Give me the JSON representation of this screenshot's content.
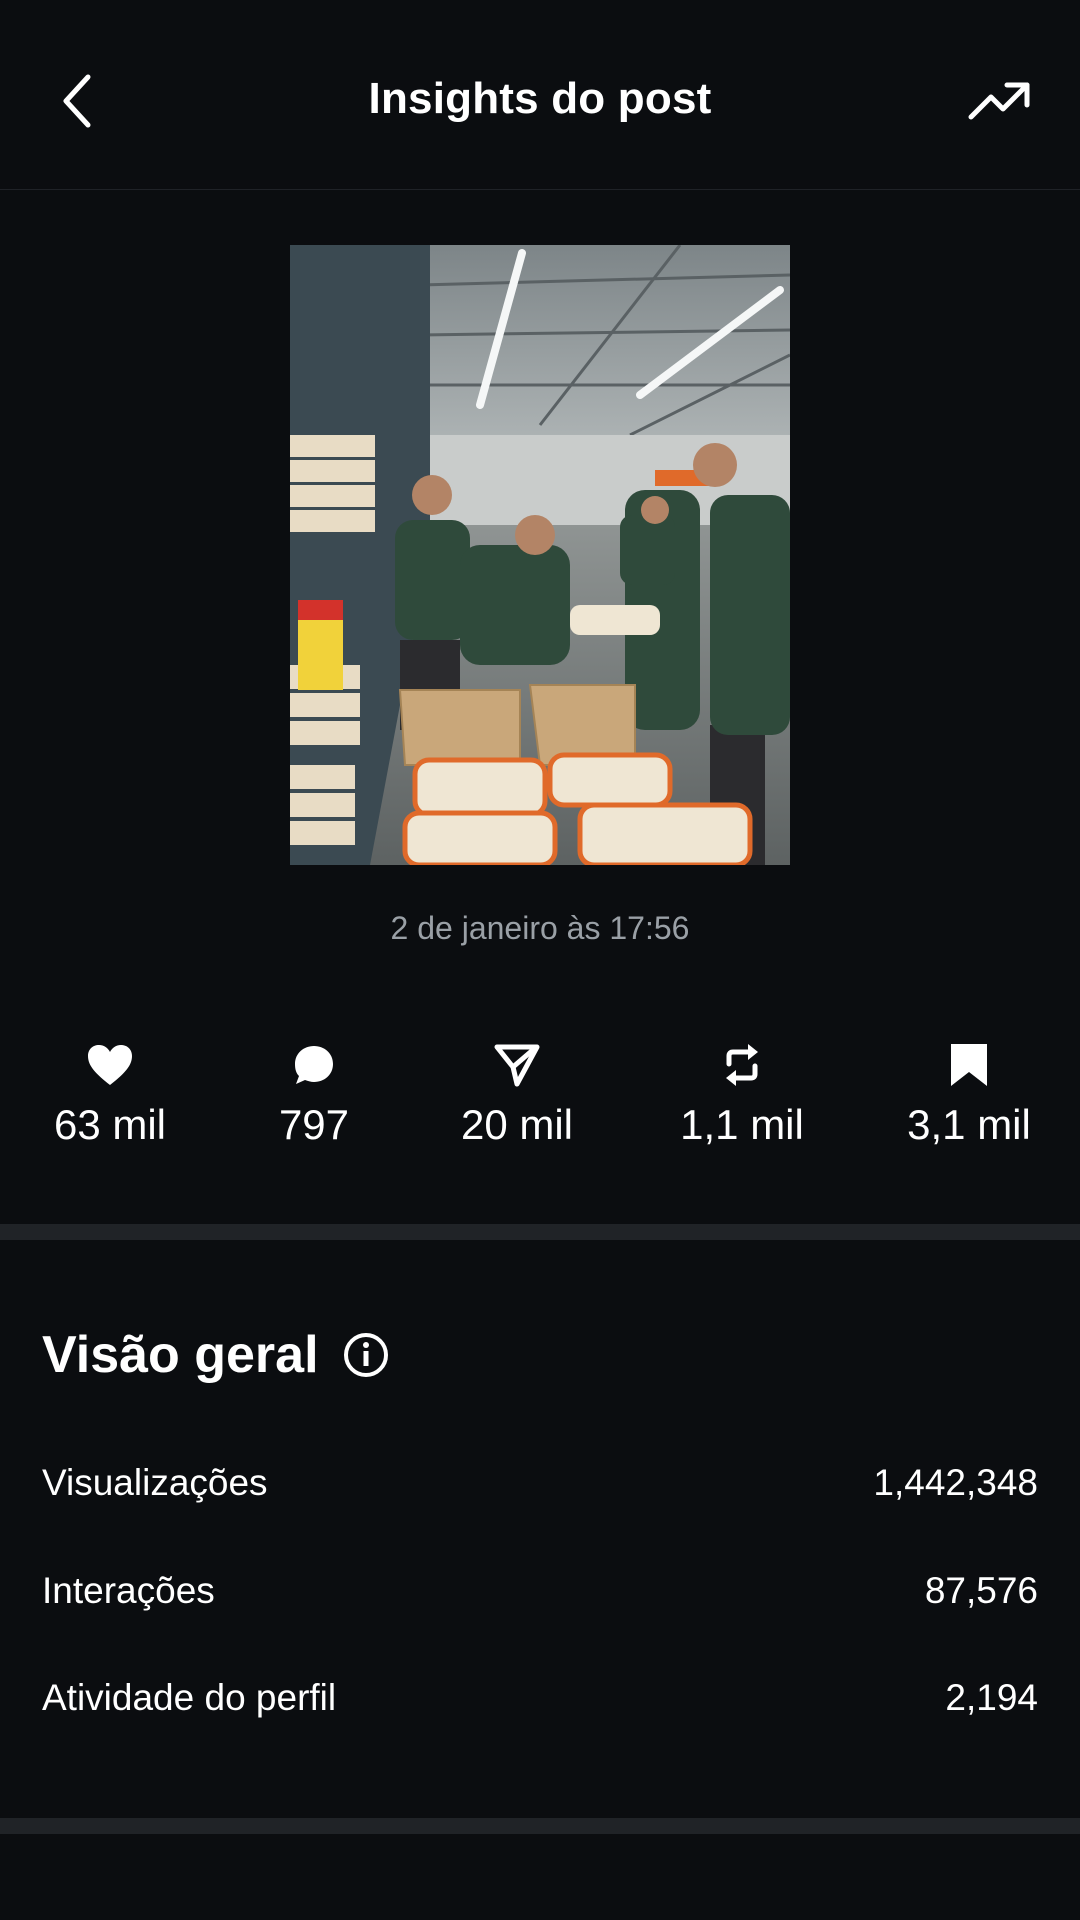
{
  "header": {
    "title": "Insights do post",
    "back_icon": "chevron-left-icon",
    "trend_icon": "trending-up-icon"
  },
  "post": {
    "image_description": "photo",
    "timestamp": "2 de janeiro às 17:56"
  },
  "metrics": [
    {
      "icon": "heart-icon",
      "value": "63 mil"
    },
    {
      "icon": "comment-icon",
      "value": "797"
    },
    {
      "icon": "share-icon",
      "value": "20 mil"
    },
    {
      "icon": "repost-icon",
      "value": "1,1 mil"
    },
    {
      "icon": "bookmark-icon",
      "value": "3,1 mil"
    }
  ],
  "overview": {
    "title": "Visão geral",
    "rows": [
      {
        "label": "Visualizações",
        "value": "1,442,348"
      },
      {
        "label": "Interações",
        "value": "87,576"
      },
      {
        "label": "Atividade do perfil",
        "value": "2,194"
      }
    ]
  },
  "colors": {
    "background": "#0b0d10",
    "divider": "#202327",
    "muted_text": "#9aa0a6",
    "text": "#ffffff"
  }
}
